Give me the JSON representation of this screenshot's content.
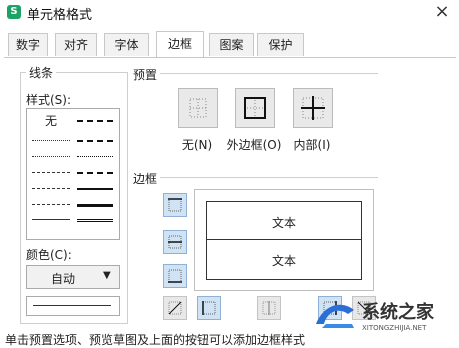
{
  "window": {
    "app_icon_letter": "S",
    "title": "单元格格式",
    "close_glyph": "×"
  },
  "tabs": [
    "数字",
    "对齐",
    "字体",
    "边框",
    "图案",
    "保护"
  ],
  "active_tab": "边框",
  "line_group": {
    "legend": "线条",
    "style_label": "样式(S):",
    "none_label": "无",
    "color_label": "颜色(C):",
    "color_value": "自动",
    "color_arrow": "▼"
  },
  "preset": {
    "label": "预置",
    "none": "无(N)",
    "outline": "外边框(O)",
    "inside": "内部(I)"
  },
  "border": {
    "label": "边框",
    "preview_text_top": "文本",
    "preview_text_bottom": "文本"
  },
  "hint": "单击预置选项、预览草图及上面的按钮可以添加边框样式",
  "watermark": {
    "cn": "系统之家",
    "en": "XITONGZHIJIA.NET"
  },
  "colors": {
    "accent_blue": "#cfe3f5",
    "button_border_blue": "#8fb2d4",
    "app_green": "#1aa364"
  }
}
